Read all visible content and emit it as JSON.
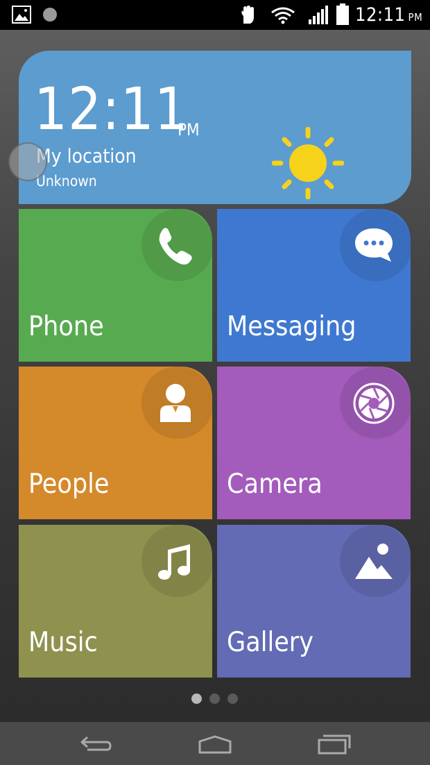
{
  "status_bar": {
    "time": "12:11",
    "ampm": "PM",
    "icons": [
      "gallery-notification-icon",
      "circle-notification-icon",
      "glove-icon",
      "wifi-icon",
      "signal-icon",
      "battery-icon"
    ]
  },
  "widget": {
    "time": "12:11",
    "ampm": "PM",
    "location": "My location",
    "location_status": "Unknown",
    "weather_icon": "sun-icon",
    "color": "#5c9ccf"
  },
  "tiles": [
    {
      "label": "Phone",
      "icon": "phone-icon",
      "color": "#58aa50"
    },
    {
      "label": "Messaging",
      "icon": "message-bubble-icon",
      "color": "#3f78d0"
    },
    {
      "label": "People",
      "icon": "person-icon",
      "color": "#d4892a"
    },
    {
      "label": "Camera",
      "icon": "camera-aperture-icon",
      "color": "#a35cbb"
    },
    {
      "label": "Music",
      "icon": "music-note-icon",
      "color": "#8f914f"
    },
    {
      "label": "Gallery",
      "icon": "landscape-icon",
      "color": "#626bb3"
    }
  ],
  "pager": {
    "pages": 3,
    "active": 1
  },
  "nav_bar": {
    "buttons": [
      "back-icon",
      "home-icon",
      "recent-apps-icon"
    ]
  }
}
